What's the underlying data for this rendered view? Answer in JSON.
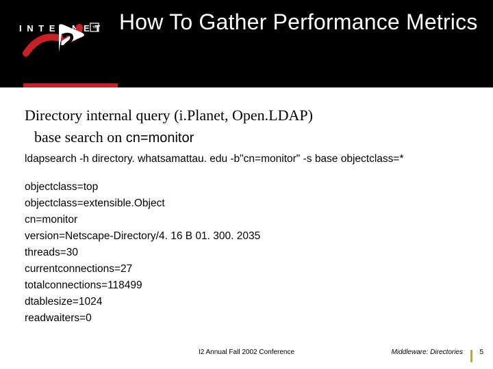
{
  "header": {
    "title": "How To Gather Performance Metrics"
  },
  "content": {
    "line1": "Directory internal query (i.Planet, Open.LDAP)",
    "line2_prefix": "base search on ",
    "line2_mono": "cn=monitor",
    "command": "ldapsearch -h directory. whatsamattau. edu -b\"cn=monitor\" -s base objectclass=*",
    "output_lines": [
      "objectclass=top",
      "objectclass=extensible.Object",
      "cn=monitor",
      "version=Netscape-Directory/4. 16 B 01. 300. 2035",
      "threads=30",
      "currentconnections=27",
      "totalconnections=118499",
      "dtablesize=1024",
      "readwaiters=0"
    ]
  },
  "footer": {
    "center": "I2 Annual Fall 2002 Conference",
    "right_title": "Middleware: Directories",
    "page_num": "5"
  },
  "logo": {
    "text_top": "INTERNET",
    "trademark": "™"
  }
}
